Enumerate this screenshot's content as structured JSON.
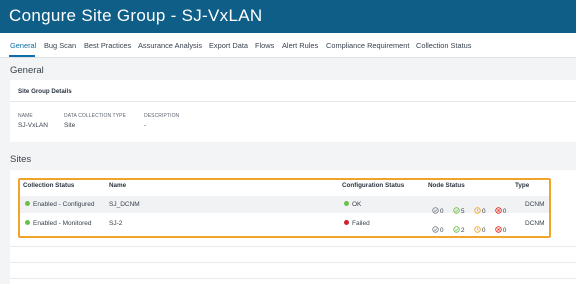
{
  "header": {
    "title": "Con​gure Site Group - SJ-VxLAN"
  },
  "tabs": [
    {
      "label": "General",
      "active": true
    },
    {
      "label": "Bug Scan"
    },
    {
      "label": "Best Practices"
    },
    {
      "label": "Assurance Analysis"
    },
    {
      "label": "Export Data"
    },
    {
      "label": "Flows"
    },
    {
      "label": "Alert Rules"
    },
    {
      "label": "Compliance Requirement"
    },
    {
      "label": "Collection Status"
    }
  ],
  "general": {
    "section_title": "General",
    "card_title": "Site Group Details",
    "name_label": "NAME",
    "name_value": "SJ-VxLAN",
    "type_label": "DATA COLLECTION TYPE",
    "type_value": "Site",
    "desc_label": "DESCRIPTION",
    "desc_value": "-"
  },
  "sites": {
    "section_title": "Sites",
    "columns": [
      "Collection Status",
      "Name",
      "Configuration Status",
      "Node Status",
      "Type"
    ],
    "rows": [
      {
        "collection_status": "Enabled - Configured",
        "collection_color": "#6cc04a",
        "name": "SJ_DCNM",
        "config_status": "OK",
        "config_color": "#6cc04a",
        "node_status": [
          "0",
          "5",
          "0",
          "0"
        ],
        "type": "DCNM"
      },
      {
        "collection_status": "Enabled - Monitored",
        "collection_color": "#6cc04a",
        "name": "SJ-2",
        "config_status": "Failed",
        "config_color": "#cf2030",
        "node_status": [
          "0",
          "2",
          "0",
          "0"
        ],
        "type": "DCNM"
      }
    ]
  },
  "colors": {
    "header_bg": "#0f5e87",
    "accent": "#0d6ea8",
    "highlight": "#f0a429",
    "status_ok": "#6cc04a",
    "status_failed": "#cf2030",
    "node_neutral": "#7c858e",
    "node_ok": "#6cc04a",
    "node_warn": "#f0a429",
    "node_error": "#e2231a"
  },
  "icons": {
    "node_neutral": "check-circle-outline-gray-icon",
    "node_ok": "check-circle-outline-green-icon",
    "node_warn": "clock-circle-outline-orange-icon",
    "node_error": "x-circle-outline-red-icon"
  }
}
